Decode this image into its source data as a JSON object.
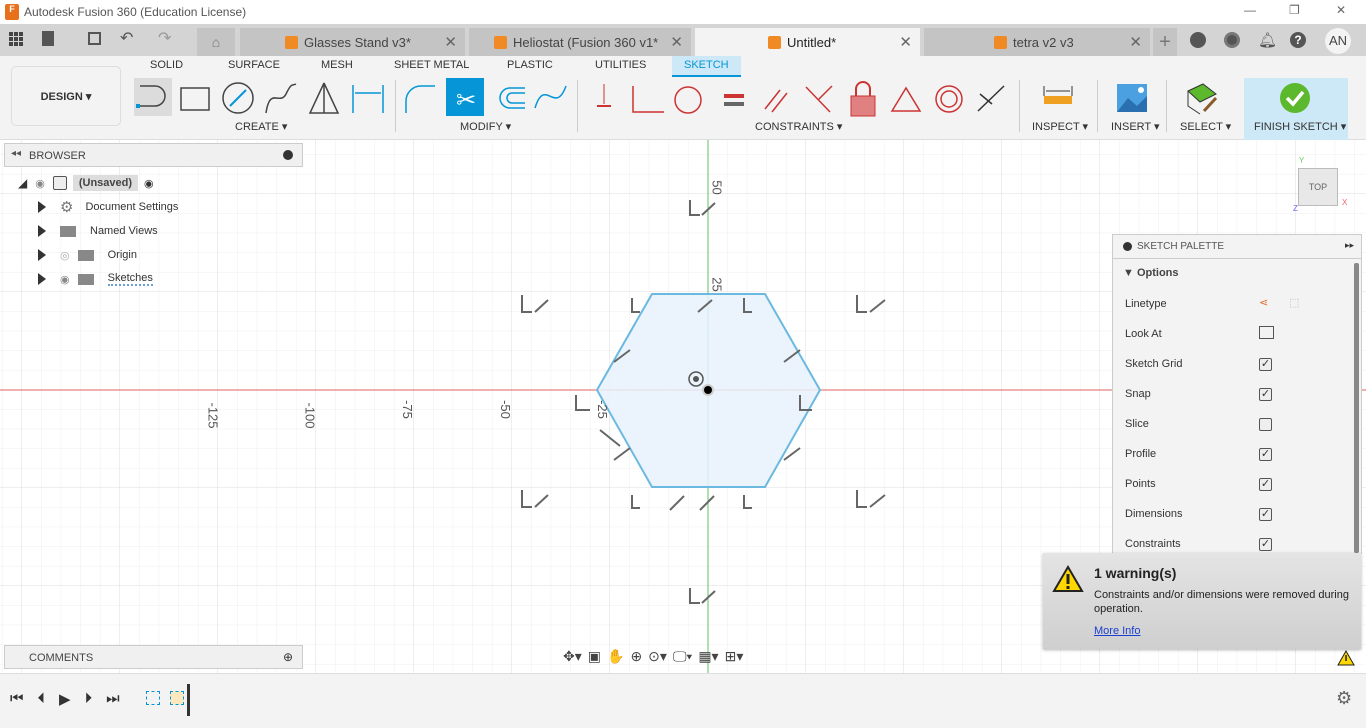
{
  "app": {
    "title": "Autodesk Fusion 360 (Education License)",
    "logo_letter": "F"
  },
  "window_controls": {
    "minimize": "—",
    "restore": "❐",
    "close": "✕"
  },
  "tabs": [
    {
      "label": "Glasses Stand v3*",
      "active": false
    },
    {
      "label": "Heliostat (Fusion 360 v1*",
      "active": false
    },
    {
      "label": "Untitled*",
      "active": true
    },
    {
      "label": "tetra v2 v3",
      "active": false
    }
  ],
  "tab_close": "✕",
  "new_tab": "+",
  "user_initials": "AN",
  "workspace": "DESIGN ▾",
  "ribbon_tabs": [
    "SOLID",
    "SURFACE",
    "MESH",
    "SHEET METAL",
    "PLASTIC",
    "UTILITIES",
    "SKETCH"
  ],
  "active_ribbon_tab": "SKETCH",
  "groups": {
    "create": "CREATE ▾",
    "modify": "MODIFY ▾",
    "constraints": "CONSTRAINTS ▾",
    "inspect": "INSPECT ▾",
    "insert": "INSERT ▾",
    "select": "SELECT ▾",
    "finish": "FINISH SKETCH ▾"
  },
  "browser": {
    "title": "BROWSER",
    "root": "(Unsaved)",
    "items": [
      "Document Settings",
      "Named Views",
      "Origin",
      "Sketches"
    ]
  },
  "comments": {
    "title": "COMMENTS"
  },
  "axis_labels": {
    "x": [
      "-125",
      "-100",
      "-75",
      "-50",
      "-25"
    ],
    "y": [
      "50",
      "25"
    ]
  },
  "viewcube": {
    "face": "TOP",
    "y": "Y",
    "x": "X",
    "z": "Z"
  },
  "sketch_palette": {
    "title": "SKETCH PALETTE",
    "section": "Options",
    "rows": [
      {
        "label": "Linetype",
        "type": "icons"
      },
      {
        "label": "Look At",
        "type": "icon"
      },
      {
        "label": "Sketch Grid",
        "checked": true
      },
      {
        "label": "Snap",
        "checked": true
      },
      {
        "label": "Slice",
        "checked": false
      },
      {
        "label": "Profile",
        "checked": true
      },
      {
        "label": "Points",
        "checked": true
      },
      {
        "label": "Dimensions",
        "checked": true
      },
      {
        "label": "Constraints",
        "checked": true
      }
    ]
  },
  "warning": {
    "title": "1 warning(s)",
    "message": "Constraints and/or dimensions were removed during operation.",
    "link": "More Info"
  },
  "colors": {
    "accent": "#0696d7",
    "finish_bg": "#cde8f6",
    "finish_check": "#5cb82c",
    "x_axis": "#e06060",
    "y_axis": "#60c060",
    "profile_fill": "#e8f2fb",
    "profile_stroke": "#6bb9e0"
  }
}
